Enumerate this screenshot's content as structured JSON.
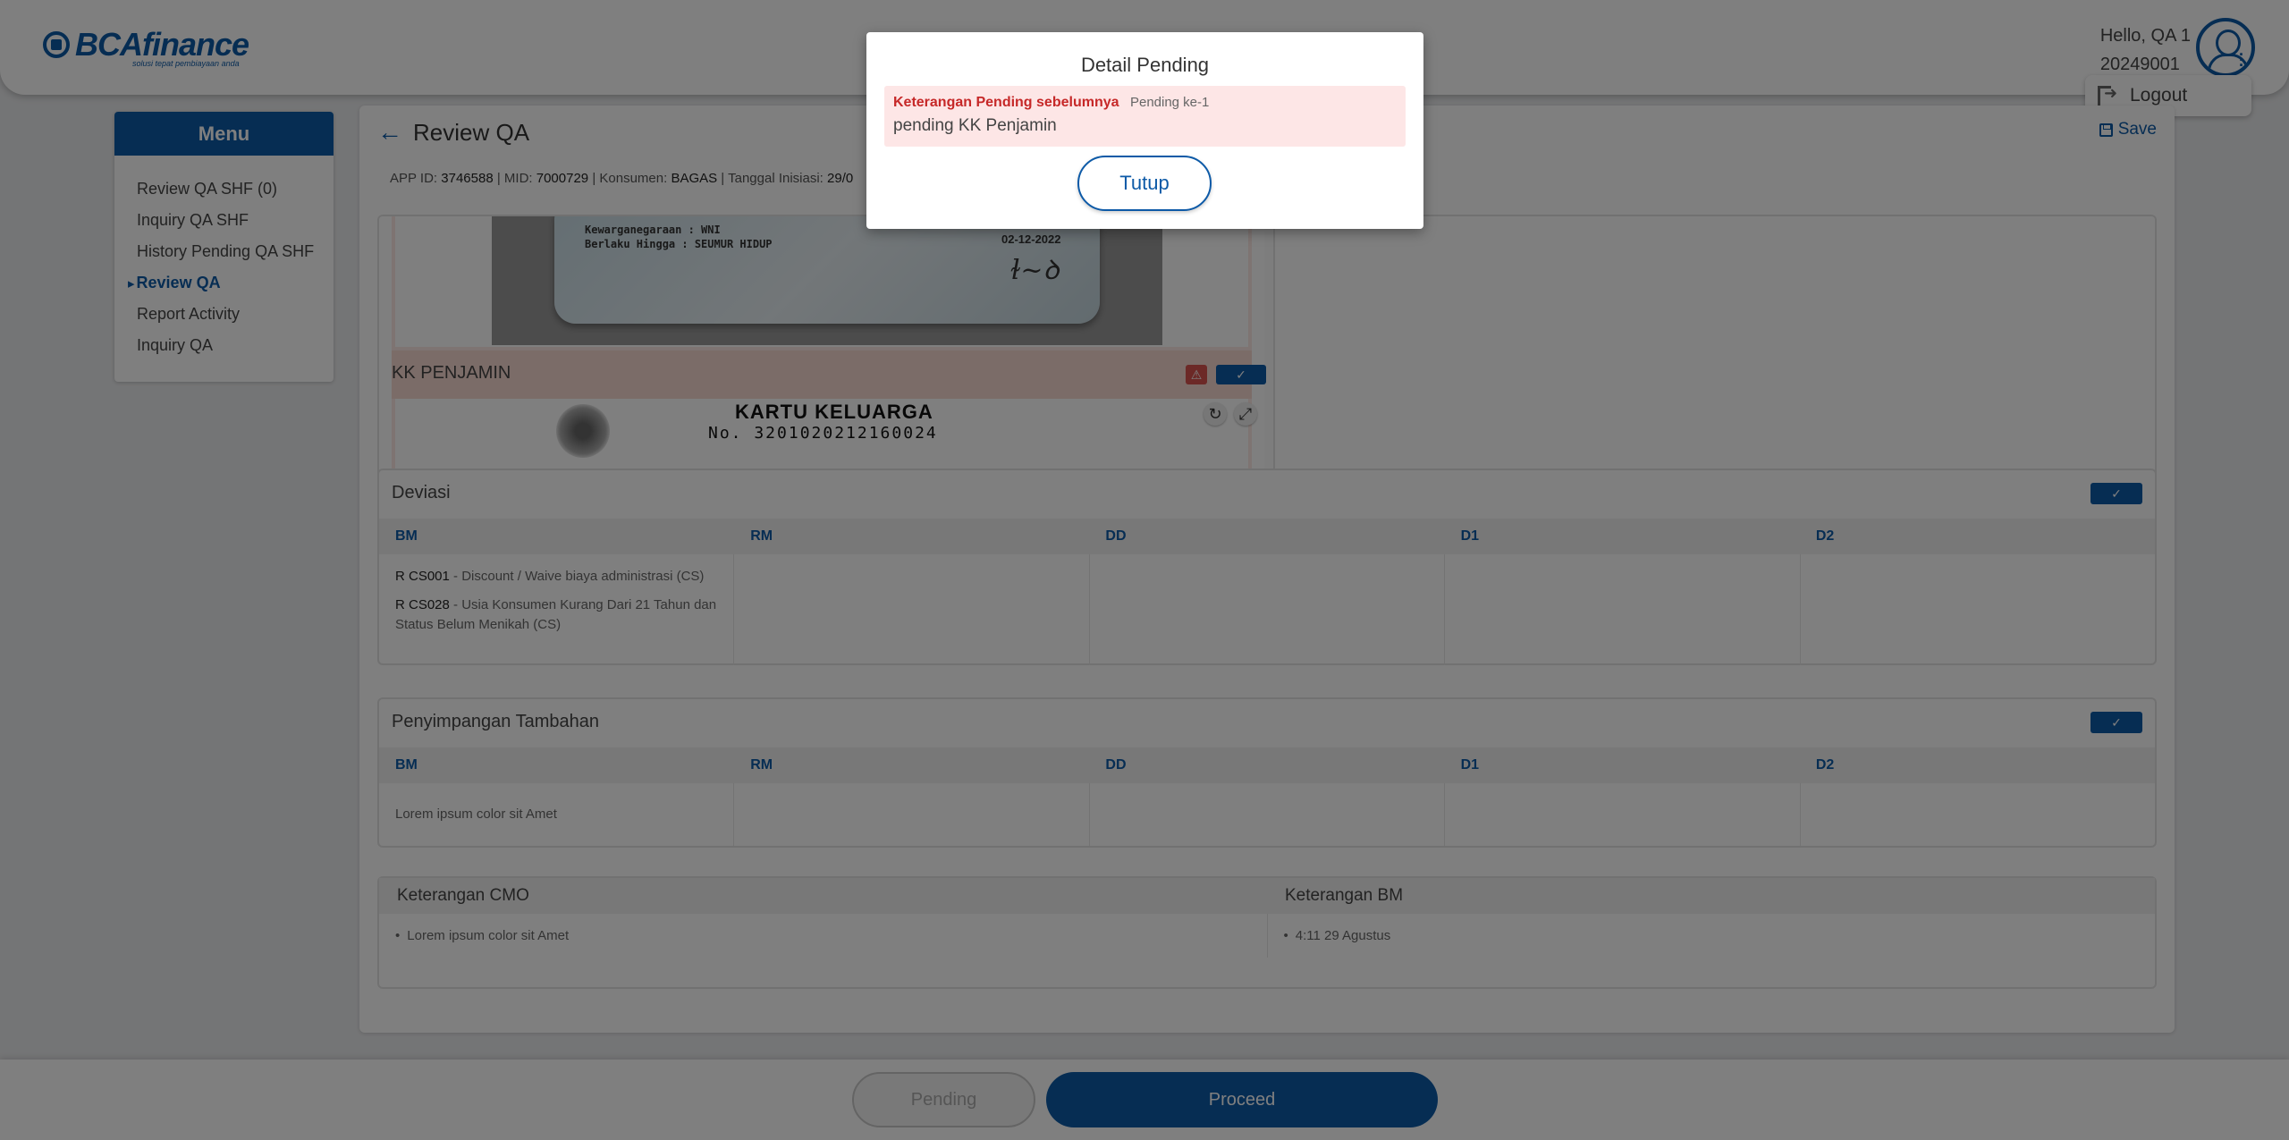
{
  "brand": {
    "name": "BCAfinance",
    "tagline": "solusi tepat pembiayaan anda",
    "color": "#0d5aa7"
  },
  "user": {
    "greeting": "Hello, QA 1",
    "id": "20249001",
    "logout_label": "Logout"
  },
  "sidebar": {
    "title": "Menu",
    "items": [
      {
        "label": "Review QA SHF (0)"
      },
      {
        "label": "Inquiry QA SHF"
      },
      {
        "label": "History Pending QA SHF"
      },
      {
        "label": "Review QA",
        "active": true
      },
      {
        "label": "Report Activity"
      },
      {
        "label": "Inquiry QA"
      }
    ]
  },
  "page": {
    "title": "Review QA",
    "save_label": "Save",
    "app_info": {
      "app_id_label": "APP ID:",
      "app_id": "3746588",
      "mid_label": "MID:",
      "mid": "7000729",
      "konsumen_label": "Konsumen:",
      "konsumen": "BAGAS",
      "tanggal_label": "Tanggal Inisiasi:",
      "tanggal": "29/0"
    }
  },
  "documents": {
    "ktp": {
      "kewarganegaraan": "Kewarganegaraan : WNI",
      "berlaku": "Berlaku Hingga    : SEUMUR HIDUP",
      "date": "02-12-2022"
    },
    "kk": {
      "section_title": "KK PENJAMIN",
      "doc_title": "KARTU KELUARGA",
      "doc_number": "No. 3201020212160024"
    }
  },
  "deviasi": {
    "title": "Deviasi",
    "columns": [
      "BM",
      "RM",
      "DD",
      "D1",
      "D2"
    ],
    "bm_items": [
      {
        "code": "R CS001",
        "text": " - Discount / Waive biaya administrasi (CS)"
      },
      {
        "code": "R CS028",
        "text": " - Usia Konsumen Kurang Dari 21 Tahun dan Status Belum Menikah (CS)"
      }
    ]
  },
  "penyimpangan": {
    "title": "Penyimpangan Tambahan",
    "columns": [
      "BM",
      "RM",
      "DD",
      "D1",
      "D2"
    ],
    "bm_text": "Lorem ipsum color sit Amet"
  },
  "keterangan": {
    "cmo_title": "Keterangan CMO",
    "bm_title": "Keterangan BM",
    "cmo_text": "Lorem ipsum color sit Amet",
    "bm_text": "4:11 29 Agustus"
  },
  "footer": {
    "pending_label": "Pending",
    "proceed_label": "Proceed"
  },
  "modal": {
    "title": "Detail Pending",
    "pending_label": "Keterangan Pending sebelumnya",
    "pending_count": "Pending ke-1",
    "pending_text": "pending KK Penjamin",
    "close_label": "Tutup"
  }
}
